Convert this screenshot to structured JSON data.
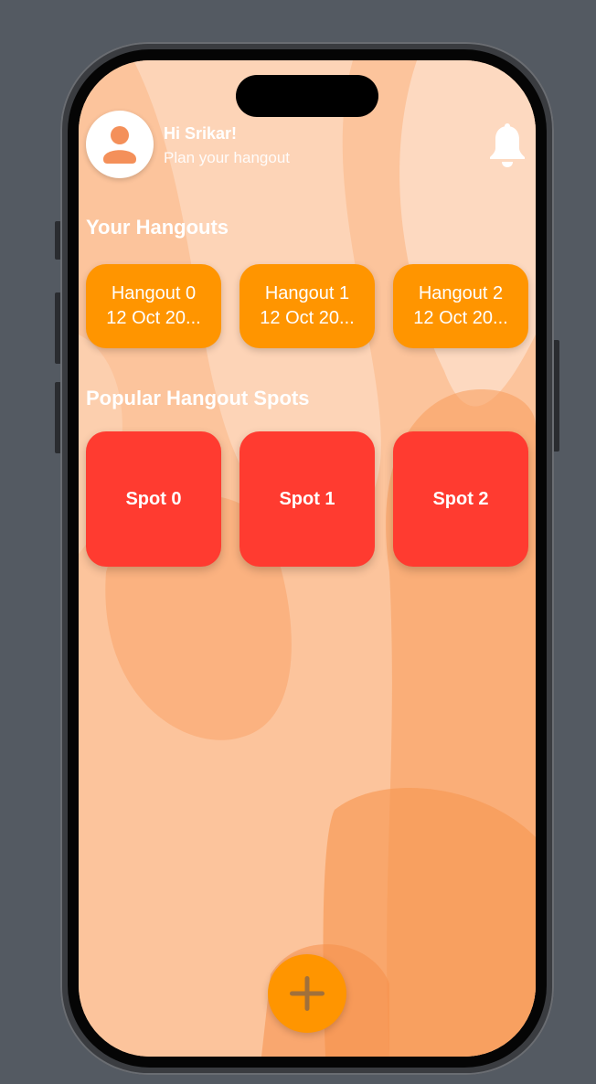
{
  "colors": {
    "accent_orange": "#ff9500",
    "spot_red": "#ff3b30",
    "text_white": "#ffffff",
    "plus_gray": "#a0703c"
  },
  "header": {
    "greeting": "Hi Srikar!",
    "subtitle": "Plan your hangout",
    "avatar_icon": "person-icon",
    "bell_icon": "bell-icon"
  },
  "hangouts": {
    "title": "Your Hangouts",
    "items": [
      {
        "name": "Hangout 0",
        "date": "12 Oct 20..."
      },
      {
        "name": "Hangout 1",
        "date": "12 Oct 20..."
      },
      {
        "name": "Hangout 2",
        "date": "12 Oct 20..."
      }
    ]
  },
  "spots": {
    "title": "Popular Hangout Spots",
    "items": [
      {
        "name": "Spot 0"
      },
      {
        "name": "Spot 1"
      },
      {
        "name": "Spot 2"
      }
    ]
  },
  "fab": {
    "icon": "plus-icon"
  }
}
